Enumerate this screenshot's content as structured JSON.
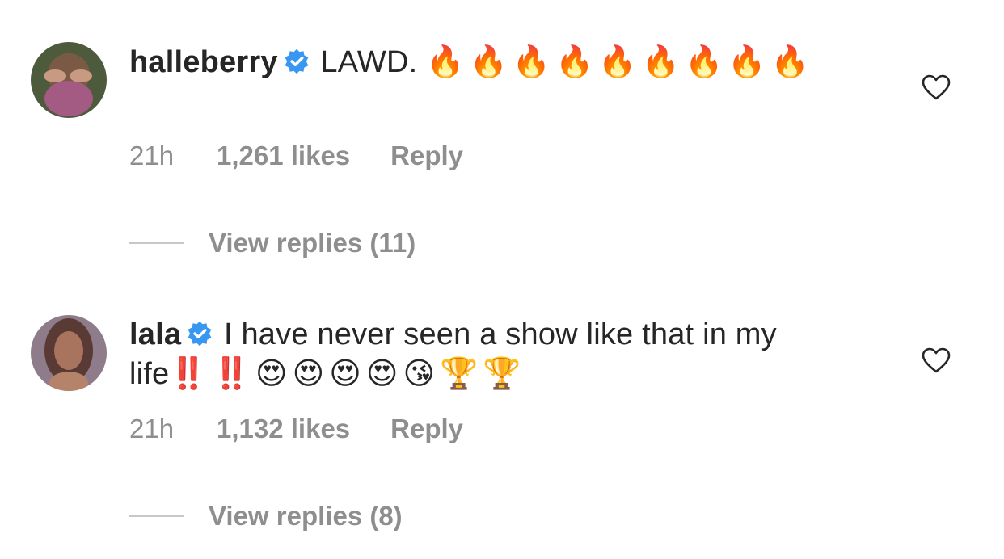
{
  "comments": [
    {
      "username": "halleberry",
      "text": "LAWD.",
      "emojis": "🔥🔥🔥🔥🔥🔥🔥🔥🔥",
      "time": "21h",
      "likes": "1,261 likes",
      "reply_label": "Reply",
      "view_replies": "View replies (11)"
    },
    {
      "username": "lala",
      "text": "I have never seen a show like that in my life",
      "emojis": "‼️‼️😍😍😍😍😘🏆🏆",
      "time": "21h",
      "likes": "1,132 likes",
      "reply_label": "Reply",
      "view_replies": "View replies (8)"
    }
  ],
  "colors": {
    "verified": "#3897f0",
    "meta_text": "#8e8e8e",
    "primary_text": "#262626"
  },
  "icons": [
    "verified-badge-icon",
    "heart-outline-icon"
  ]
}
